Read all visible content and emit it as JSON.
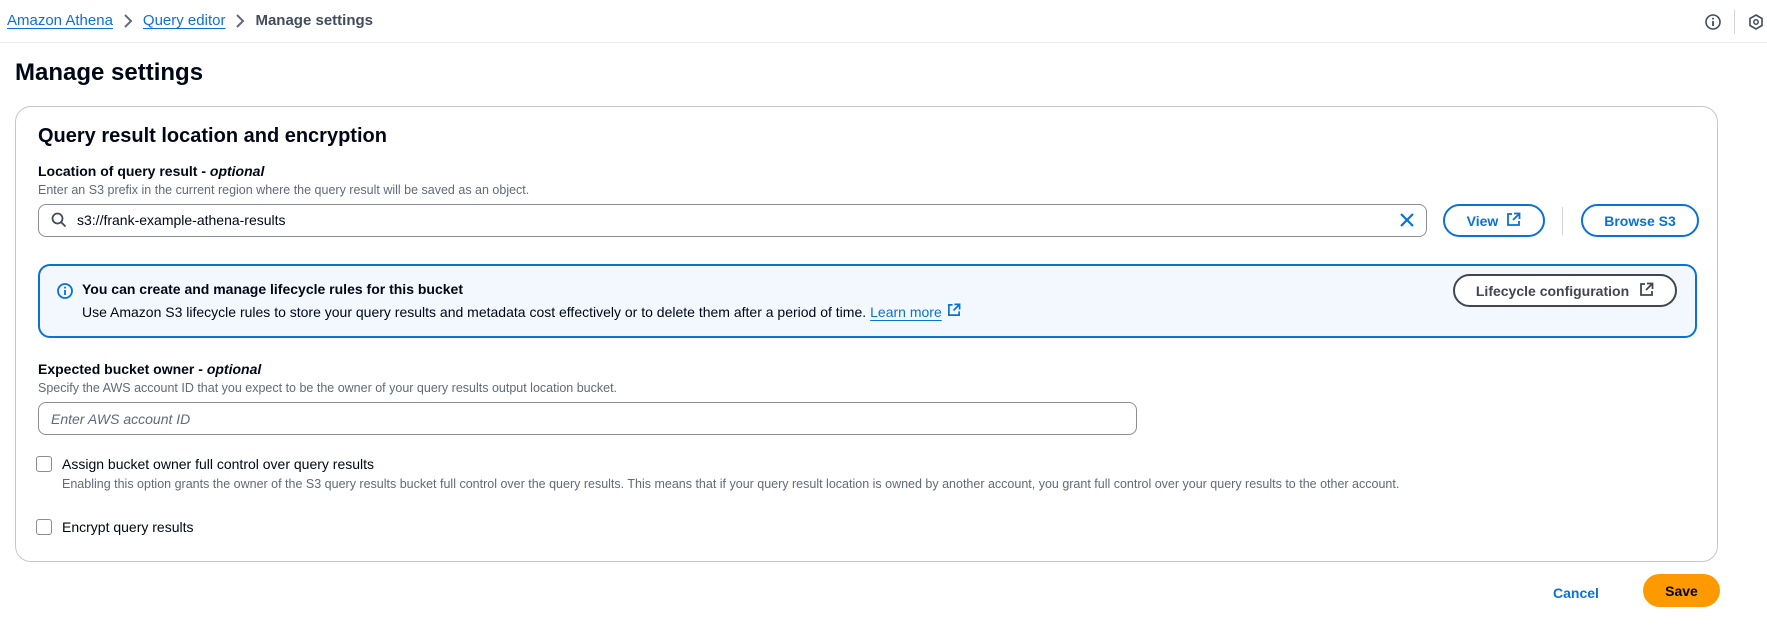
{
  "breadcrumb": {
    "items": [
      {
        "label": "Amazon Athena"
      },
      {
        "label": "Query editor"
      }
    ],
    "current": "Manage settings"
  },
  "header_icons": [
    "info-icon",
    "hexagon-settings-icon"
  ],
  "page": {
    "title": "Manage settings"
  },
  "panel": {
    "title": "Query result location and encryption",
    "location": {
      "label": "Location of query result -",
      "optional": "optional",
      "description": "Enter an S3 prefix in the current region where the query result will be saved as an object.",
      "value": "s3://frank-example-athena-results",
      "view_label": "View",
      "browse_label": "Browse S3"
    },
    "alert": {
      "title": "You can create and manage lifecycle rules for this bucket",
      "text": "Use Amazon S3 lifecycle rules to store your query results and metadata cost effectively or to delete them after a period of time.",
      "link_label": "Learn more",
      "button_label": "Lifecycle configuration"
    },
    "owner": {
      "label": "Expected bucket owner -",
      "optional": "optional",
      "description": "Specify the AWS account ID that you expect to be the owner of your query results output location bucket.",
      "placeholder": "Enter AWS account ID",
      "value": ""
    },
    "full_control": {
      "label": "Assign bucket owner full control over query results",
      "description": "Enabling this option grants the owner of the S3 query results bucket full control over the query results. This means that if your query result location is owned by another account, you grant full control over your query results to the other account.",
      "checked": false
    },
    "encrypt": {
      "label": "Encrypt query results",
      "checked": false
    }
  },
  "footer": {
    "cancel_label": "Cancel",
    "save_label": "Save"
  },
  "colors": {
    "link_blue": "#0972d3",
    "primary_orange": "#ff9900",
    "info_background": "#f2f8fd",
    "text_dark": "#000716",
    "text_secondary": "#5f6b7a"
  }
}
